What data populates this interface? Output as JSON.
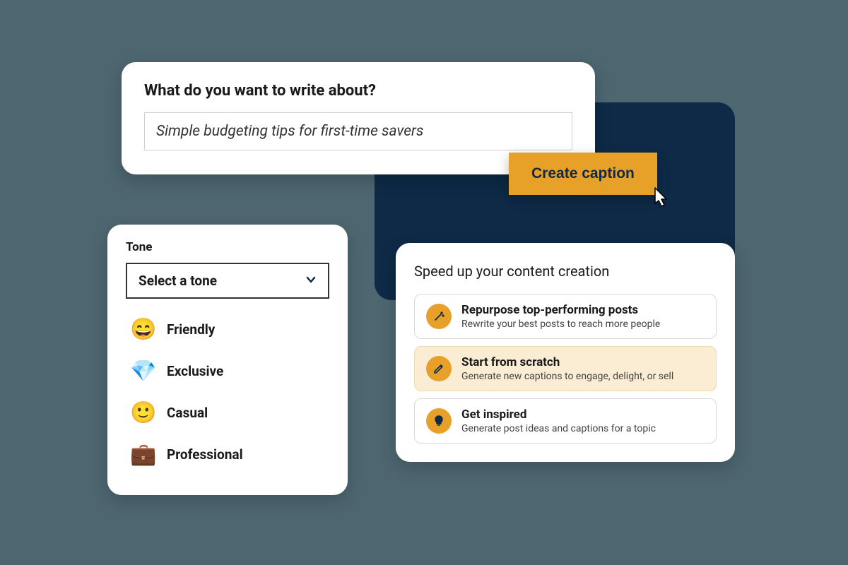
{
  "prompt": {
    "title": "What do you want to write about?",
    "value": "Simple budgeting tips for first-time savers"
  },
  "create_button": "Create caption",
  "tone": {
    "label": "Tone",
    "placeholder": "Select a tone",
    "options": [
      {
        "emoji": "😄",
        "label": "Friendly"
      },
      {
        "emoji": "💎",
        "label": "Exclusive"
      },
      {
        "emoji": "🙂",
        "label": "Casual"
      },
      {
        "emoji": "💼",
        "label": "Professional"
      }
    ]
  },
  "speed": {
    "title": "Speed up your content creation",
    "options": [
      {
        "title": "Repurpose top-performing posts",
        "desc": "Rewrite your best posts to reach more people",
        "selected": false
      },
      {
        "title": "Start from scratch",
        "desc": "Generate new captions to engage, delight, or sell",
        "selected": true
      },
      {
        "title": "Get inspired",
        "desc": "Generate post ideas and captions for a topic",
        "selected": false
      }
    ]
  }
}
